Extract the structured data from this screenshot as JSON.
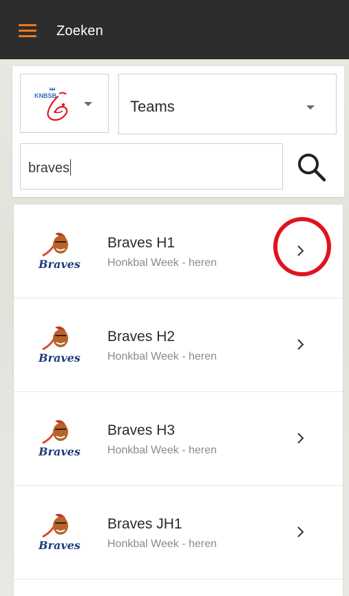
{
  "appbar": {
    "title": "Zoeken",
    "menu_icon": "hamburger-menu-icon",
    "accent_color": "#f07a1a"
  },
  "search": {
    "federation_logo": "KNBSB",
    "type_select_value": "Teams",
    "query": "braves",
    "search_icon": "search-icon"
  },
  "results": [
    {
      "name": "Braves H1",
      "subtitle": "Honkbal Week - heren",
      "highlighted": true
    },
    {
      "name": "Braves H2",
      "subtitle": "Honkbal Week - heren",
      "highlighted": false
    },
    {
      "name": "Braves H3",
      "subtitle": "Honkbal Week - heren",
      "highlighted": false
    },
    {
      "name": "Braves JH1",
      "subtitle": "Honkbal Week - heren",
      "highlighted": false
    }
  ],
  "team_logo_text": "Braves",
  "highlight_color": "#e0141e"
}
